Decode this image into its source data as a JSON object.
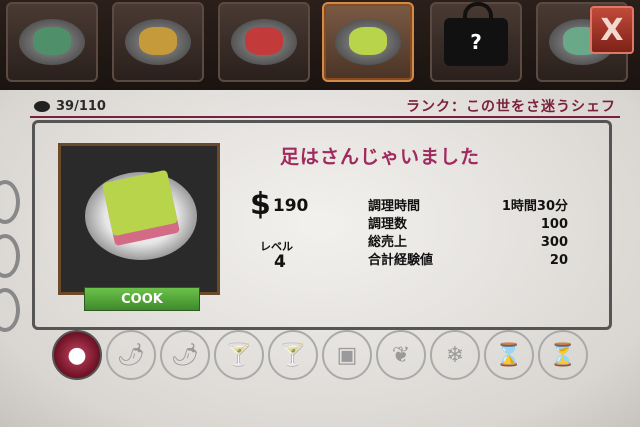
{
  "tabs": [
    {
      "name": "tab-cucumber",
      "food_color": "#4f8f6a",
      "dim": true
    },
    {
      "name": "tab-fries",
      "food_color": "#c59a3a",
      "dim": true
    },
    {
      "name": "tab-jelly",
      "food_color": "#c23a3a",
      "dim": true
    },
    {
      "name": "tab-sandwich",
      "food_color": "#b8d44a",
      "dim": false,
      "active": true
    },
    {
      "name": "tab-locked",
      "locked": true,
      "lock_mark": "?"
    },
    {
      "name": "tab-partial",
      "food_color": "#6aa88a",
      "dim": true
    }
  ],
  "close_label": "X",
  "count": "39/110",
  "rank": "ランク：この世をさ迷うシェフ",
  "recipe": {
    "title": "足はさんじゃいました",
    "price_symbol": "$",
    "price": "190",
    "level_label": "レベル",
    "level": "4",
    "stats": [
      {
        "label": "調理時間",
        "value": "1時間30分"
      },
      {
        "label": "調理数",
        "value": "100"
      },
      {
        "label": "総売上",
        "value": "300"
      },
      {
        "label": "合計経験値",
        "value": "20"
      }
    ],
    "cook_label": "COOK"
  },
  "category_icons": [
    "sauce-icon",
    "pepper-icon",
    "chili-icon",
    "cocktail-icon",
    "drinks-icon",
    "takeout-box-icon",
    "leaf-icon",
    "snowflake-icon",
    "hourglass-icon",
    "hourglass-slash-icon"
  ]
}
